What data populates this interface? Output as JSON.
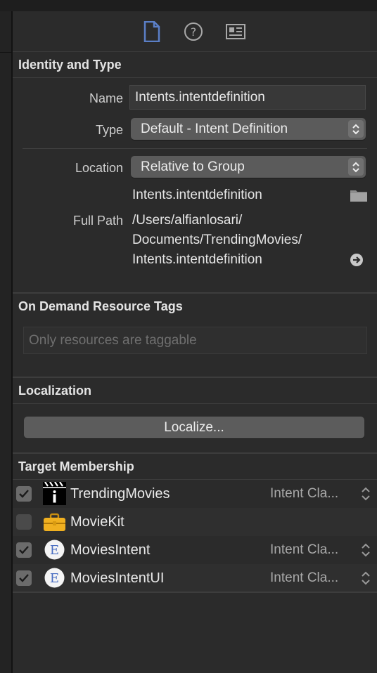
{
  "tabs": [
    {
      "icon": "file-inspector-icon",
      "active": true
    },
    {
      "icon": "quick-help-icon",
      "active": false
    },
    {
      "icon": "identity-inspector-icon",
      "active": false
    }
  ],
  "identity": {
    "title": "Identity and Type",
    "name_label": "Name",
    "name_value": "Intents.intentdefinition",
    "type_label": "Type",
    "type_value": "Default - Intent Definition",
    "location_label": "Location",
    "location_value": "Relative to Group",
    "location_file": "Intents.intentdefinition",
    "fullpath_label": "Full Path",
    "fullpath_line1": "/Users/alfianlosari/",
    "fullpath_line2": "Documents/TrendingMovies/",
    "fullpath_line3": "Intents.intentdefinition"
  },
  "on_demand": {
    "title": "On Demand Resource Tags",
    "placeholder": "Only resources are taggable"
  },
  "localization": {
    "title": "Localization",
    "button": "Localize..."
  },
  "target_membership": {
    "title": "Target Membership",
    "rows": [
      {
        "name": "TrendingMovies",
        "checked": true,
        "icon": "app-target-icon",
        "type": "Intent Cla..."
      },
      {
        "name": "MovieKit",
        "checked": false,
        "icon": "framework-toolbox-icon",
        "type": ""
      },
      {
        "name": "MoviesIntent",
        "checked": true,
        "icon": "extension-icon",
        "type": "Intent Cla..."
      },
      {
        "name": "MoviesIntentUI",
        "checked": true,
        "icon": "extension-icon",
        "type": "Intent Cla..."
      }
    ]
  },
  "colors": {
    "background": "#2b2b2b",
    "accent": "#5b7fc7"
  }
}
